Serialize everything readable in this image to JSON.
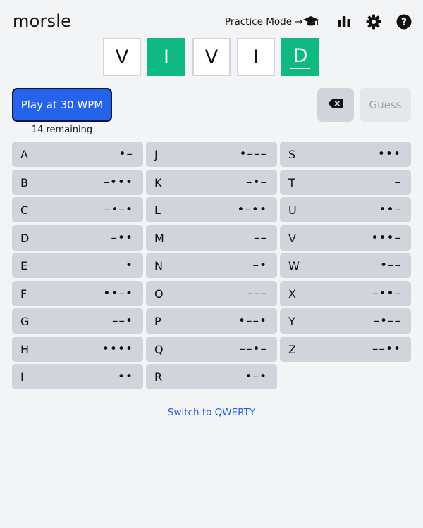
{
  "app": {
    "title": "morsle"
  },
  "header": {
    "practice_label": "Practice Mode →",
    "icons": [
      "graduation-cap-icon",
      "stats-bar-icon",
      "gear-icon",
      "help-icon"
    ]
  },
  "guess_tiles": [
    {
      "letter": "V",
      "state": "absent"
    },
    {
      "letter": "I",
      "state": "correct"
    },
    {
      "letter": "V",
      "state": "absent"
    },
    {
      "letter": "I",
      "state": "absent"
    },
    {
      "letter": "D",
      "state": "correct-active"
    }
  ],
  "controls": {
    "play_label": "Play at 30 WPM",
    "remaining_text": "14 remaining",
    "guess_label": "Guess",
    "backspace_icon": "backspace-icon"
  },
  "keys": [
    {
      "letter": "A",
      "code": "•–"
    },
    {
      "letter": "B",
      "code": "–•••"
    },
    {
      "letter": "C",
      "code": "–•–•"
    },
    {
      "letter": "D",
      "code": "–••"
    },
    {
      "letter": "E",
      "code": "•"
    },
    {
      "letter": "F",
      "code": "••–•"
    },
    {
      "letter": "G",
      "code": "––•"
    },
    {
      "letter": "H",
      "code": "••••"
    },
    {
      "letter": "I",
      "code": "••"
    },
    {
      "letter": "J",
      "code": "•–––"
    },
    {
      "letter": "K",
      "code": "–•–"
    },
    {
      "letter": "L",
      "code": "•–••"
    },
    {
      "letter": "M",
      "code": "––"
    },
    {
      "letter": "N",
      "code": "–•"
    },
    {
      "letter": "O",
      "code": "–––"
    },
    {
      "letter": "P",
      "code": "•––•"
    },
    {
      "letter": "Q",
      "code": "––•–"
    },
    {
      "letter": "R",
      "code": "•–•"
    },
    {
      "letter": "S",
      "code": "•••"
    },
    {
      "letter": "T",
      "code": "–"
    },
    {
      "letter": "U",
      "code": "••–"
    },
    {
      "letter": "V",
      "code": "•••–"
    },
    {
      "letter": "W",
      "code": "•––"
    },
    {
      "letter": "X",
      "code": "–••–"
    },
    {
      "letter": "Y",
      "code": "–•––"
    },
    {
      "letter": "Z",
      "code": "––••"
    }
  ],
  "footer": {
    "switch_label": "Switch to QWERTY"
  },
  "colors": {
    "accent": "#2563eb",
    "correct": "#10b981",
    "key_bg": "#d1d5db"
  }
}
